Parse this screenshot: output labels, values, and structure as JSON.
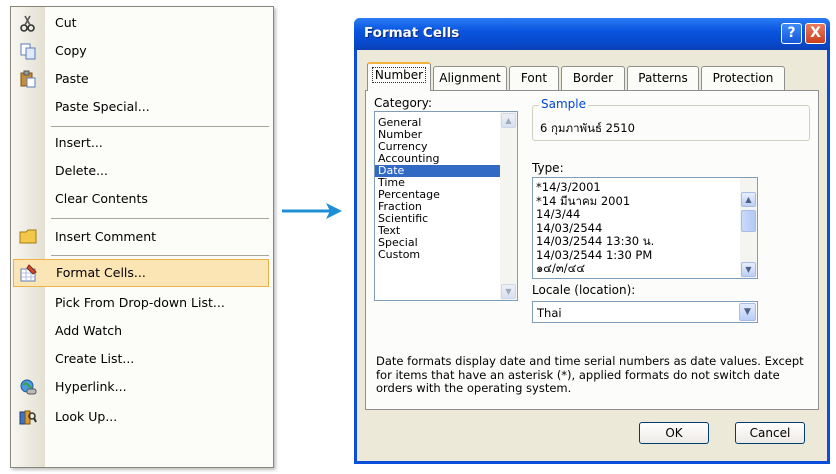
{
  "context_menu": {
    "items": [
      {
        "label": "Cut",
        "icon": "scissors-icon"
      },
      {
        "label": "Copy",
        "icon": "copy-icon"
      },
      {
        "label": "Paste",
        "icon": "clipboard-paste-icon"
      },
      {
        "label": "Paste Special..."
      },
      {
        "label": "Insert..."
      },
      {
        "label": "Delete..."
      },
      {
        "label": "Clear Contents"
      },
      {
        "label": "Insert Comment",
        "icon": "comment-icon"
      },
      {
        "label": "Format Cells...",
        "icon": "format-cells-icon",
        "highlighted": true
      },
      {
        "label": "Pick From Drop-down List..."
      },
      {
        "label": "Add Watch"
      },
      {
        "label": "Create List..."
      },
      {
        "label": "Hyperlink...",
        "icon": "hyperlink-globe-icon"
      },
      {
        "label": "Look Up...",
        "icon": "research-books-icon"
      }
    ]
  },
  "dialog": {
    "title": "Format Cells",
    "help_button": "?",
    "close_button": "X",
    "tabs": [
      "Number",
      "Alignment",
      "Font",
      "Border",
      "Patterns",
      "Protection"
    ],
    "active_tab": "Number",
    "category_label": "Category:",
    "categories": [
      "General",
      "Number",
      "Currency",
      "Accounting",
      "Date",
      "Time",
      "Percentage",
      "Fraction",
      "Scientific",
      "Text",
      "Special",
      "Custom"
    ],
    "selected_category": "Date",
    "sample_label": "Sample",
    "sample_value": "6 กุมภาพันธ์ 2510",
    "type_label": "Type:",
    "types": [
      "*14/3/2001",
      "*14 มีนาคม 2001",
      "14/3/44",
      "14/03/2544",
      "14/03/2544 13:30 น.",
      "14/03/2544 1:30 PM",
      "๑๔/๓/๔๔"
    ],
    "locale_label": "Locale (location):",
    "locale_value": "Thai",
    "description": "Date formats display date and time serial numbers as date values. Except for items that have an asterisk (*), applied formats do not switch date orders with the operating system.",
    "ok_label": "OK",
    "cancel_label": "Cancel"
  },
  "colors": {
    "titlebar": "#0a55e0",
    "selection": "#316ac5",
    "menu_highlight": "#fbe5b5",
    "arrow": "#1c8fd6"
  }
}
